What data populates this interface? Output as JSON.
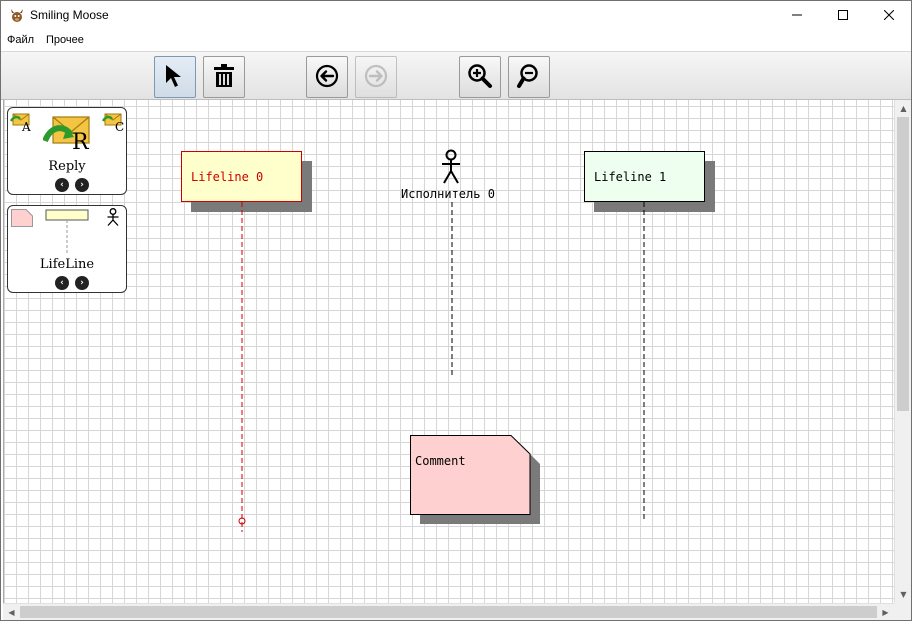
{
  "window": {
    "title": "Smiling Moose",
    "minimize_icon": "minimize-icon",
    "maximize_icon": "maximize-icon",
    "close_icon": "close-icon"
  },
  "menu": {
    "items": [
      {
        "label": "Файл"
      },
      {
        "label": "Прочее"
      }
    ]
  },
  "toolbar": {
    "buttons": [
      {
        "icon": "pointer-arrow-icon",
        "state": "active"
      },
      {
        "icon": "trash-icon",
        "state": "normal"
      },
      {
        "icon": "undo-circle-arrow-icon",
        "state": "normal"
      },
      {
        "icon": "redo-circle-arrow-icon",
        "state": "disabled"
      },
      {
        "icon": "zoom-in-icon",
        "state": "normal"
      },
      {
        "icon": "zoom-out-icon",
        "state": "normal"
      }
    ]
  },
  "palette": {
    "reply": {
      "label": "Reply",
      "big_letter": "R",
      "small_left": "A",
      "small_right": "C"
    },
    "lifeline": {
      "label": "LifeLine"
    }
  },
  "diagram": {
    "lifeline0": {
      "label": "Lifeline 0",
      "fill": "#ffffcc",
      "border": "#cc0000",
      "text_color": "#cc0000",
      "line_color": "#cc0000"
    },
    "actor0": {
      "label": "Исполнитель 0"
    },
    "lifeline1": {
      "label": "Lifeline 1",
      "fill": "#efffef",
      "border": "#000000"
    },
    "comment": {
      "label": "Comment",
      "fill": "#ffd0d0"
    }
  }
}
